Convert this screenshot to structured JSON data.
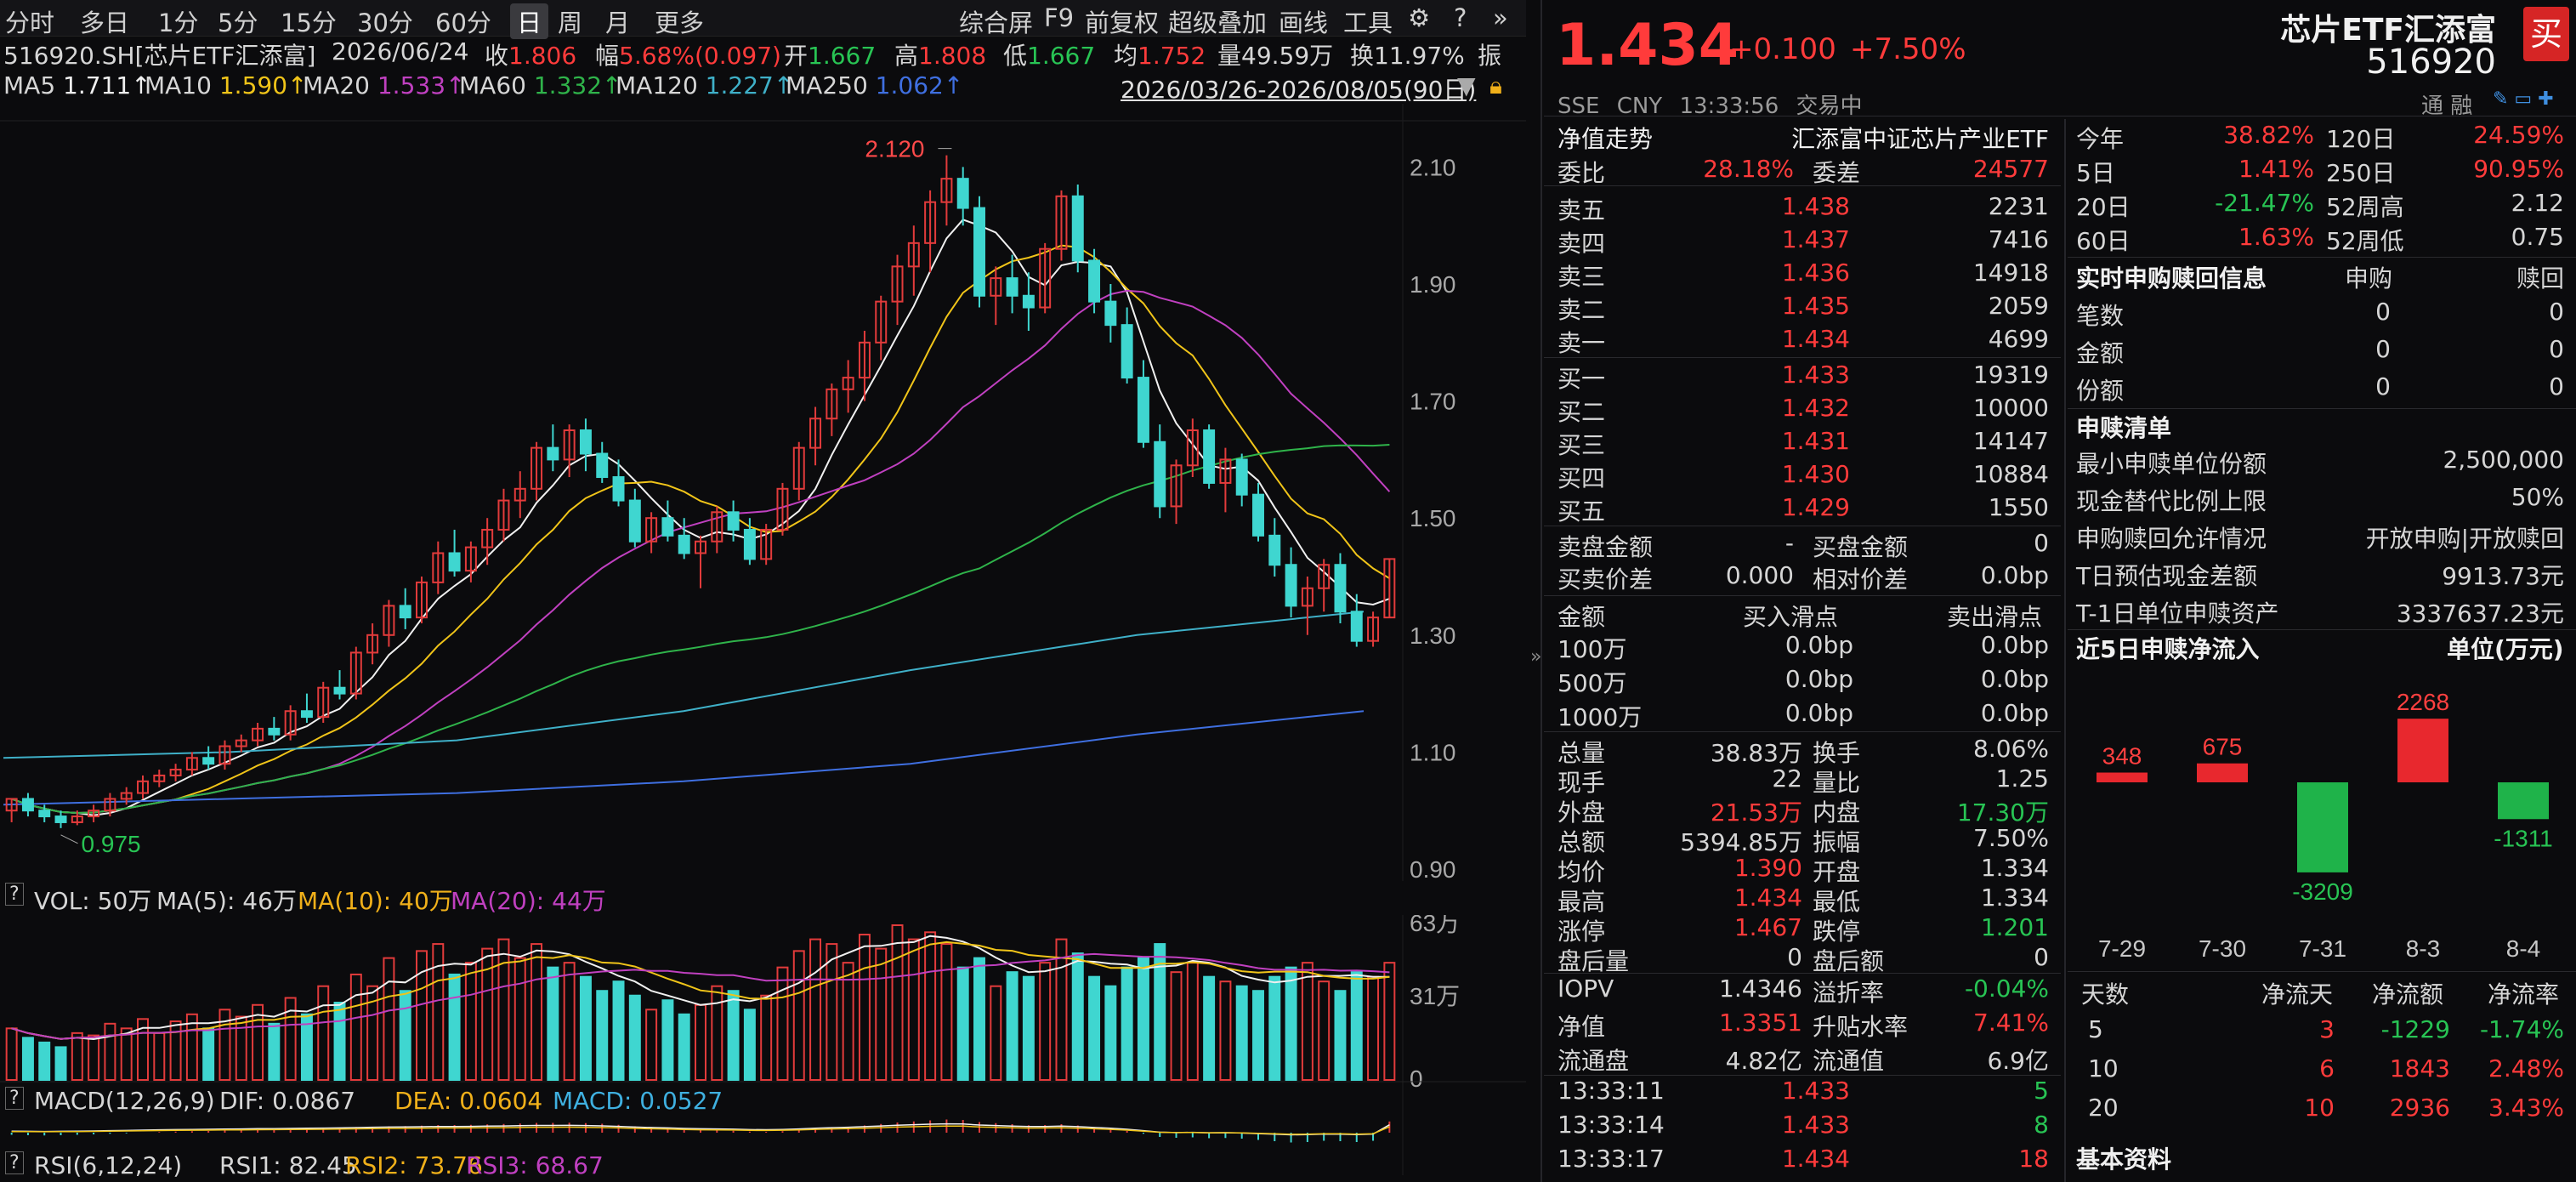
{
  "toolbar": {
    "periods": [
      "分时",
      "多日",
      "1分",
      "5分",
      "15分",
      "30分",
      "60分",
      "日",
      "周",
      "月",
      "更多"
    ],
    "active_period": "日",
    "right_items": [
      "综合屏",
      "F9",
      "前复权",
      "超级叠加",
      "画线",
      "工具"
    ]
  },
  "info": {
    "code": "516920.SH[芯片ETF汇添富]",
    "date": "2026/06/24",
    "close_label": "收",
    "close": "1.806",
    "chg_label": "幅",
    "chg": "5.68%(0.097)",
    "open_label": "开",
    "open": "1.667",
    "high_label": "高",
    "high": "1.808",
    "low_label": "低",
    "low": "1.667",
    "avg_label": "均",
    "avg": "1.752",
    "vol_label": "量",
    "vol": "49.59万",
    "turn_label": "换",
    "turn": "11.97%",
    "amp_label": "振"
  },
  "ma": {
    "ma5_label": "MA5",
    "ma5": "1.711↑",
    "ma10_label": "MA10",
    "ma10": "1.590↑",
    "ma20_label": "MA20",
    "ma20": "1.533↑",
    "ma60_label": "MA60",
    "ma60": "1.332↑",
    "ma120_label": "MA120",
    "ma120": "1.227↑",
    "ma250_label": "MA250",
    "ma250": "1.062↑",
    "range": "2026/03/26-2026/08/05(90日)"
  },
  "colors": {
    "ma5": "#f0f0f0",
    "ma10": "#f0c419",
    "ma20": "#c040c0",
    "ma60": "#2fb34a",
    "ma120": "#3fb0c8",
    "ma250": "#3f6fe0",
    "up": "#e23b3b",
    "down": "#3fd6d0"
  },
  "chart_data": {
    "type": "candlestick",
    "price_axis_ticks": [
      "2.10",
      "1.90",
      "1.70",
      "1.50",
      "1.30",
      "1.10",
      "0.90"
    ],
    "ylim": [
      0.9,
      2.15
    ],
    "max_label": "2.120",
    "min_label": "0.975",
    "volume_axis_ticks": [
      "63万",
      "31万",
      "0"
    ],
    "vol_label": "VOL: 50万",
    "vol_ma5": "MA(5): 46万",
    "vol_ma10": "MA(10): 40万",
    "vol_ma20": "MA(20): 44万",
    "macd_label": "MACD(12,26,9)",
    "dif": "DIF: 0.0867",
    "dea": "DEA: 0.0604",
    "macd": "MACD: 0.0527",
    "rsi_label": "RSI(6,12,24)",
    "rsi1": "RSI1: 82.45",
    "rsi2": "RSI2: 73.76",
    "rsi3": "RSI3: 68.67",
    "candles": [
      [
        1.0,
        1.02,
        0.98,
        1.02
      ],
      [
        1.02,
        1.03,
        0.99,
        1.0
      ],
      [
        1.0,
        1.01,
        0.98,
        0.99
      ],
      [
        0.99,
        1.0,
        0.97,
        0.98
      ],
      [
        0.98,
        1.0,
        0.975,
        0.99
      ],
      [
        0.99,
        1.01,
        0.98,
        1.0
      ],
      [
        1.0,
        1.03,
        0.99,
        1.02
      ],
      [
        1.02,
        1.04,
        1.01,
        1.03
      ],
      [
        1.03,
        1.06,
        1.02,
        1.05
      ],
      [
        1.05,
        1.07,
        1.04,
        1.06
      ],
      [
        1.06,
        1.08,
        1.05,
        1.07
      ],
      [
        1.07,
        1.1,
        1.06,
        1.09
      ],
      [
        1.09,
        1.11,
        1.07,
        1.08
      ],
      [
        1.08,
        1.12,
        1.07,
        1.11
      ],
      [
        1.11,
        1.13,
        1.1,
        1.12
      ],
      [
        1.12,
        1.15,
        1.11,
        1.14
      ],
      [
        1.14,
        1.16,
        1.12,
        1.13
      ],
      [
        1.13,
        1.18,
        1.12,
        1.17
      ],
      [
        1.17,
        1.2,
        1.15,
        1.16
      ],
      [
        1.16,
        1.22,
        1.15,
        1.21
      ],
      [
        1.21,
        1.24,
        1.19,
        1.2
      ],
      [
        1.2,
        1.28,
        1.19,
        1.27
      ],
      [
        1.27,
        1.32,
        1.25,
        1.3
      ],
      [
        1.3,
        1.36,
        1.28,
        1.35
      ],
      [
        1.35,
        1.38,
        1.31,
        1.33
      ],
      [
        1.33,
        1.4,
        1.32,
        1.39
      ],
      [
        1.39,
        1.46,
        1.37,
        1.44
      ],
      [
        1.44,
        1.48,
        1.4,
        1.41
      ],
      [
        1.41,
        1.46,
        1.39,
        1.45
      ],
      [
        1.45,
        1.5,
        1.42,
        1.48
      ],
      [
        1.48,
        1.55,
        1.46,
        1.53
      ],
      [
        1.53,
        1.58,
        1.5,
        1.55
      ],
      [
        1.55,
        1.63,
        1.53,
        1.62
      ],
      [
        1.62,
        1.66,
        1.58,
        1.6
      ],
      [
        1.6,
        1.66,
        1.57,
        1.65
      ],
      [
        1.65,
        1.67,
        1.58,
        1.61
      ],
      [
        1.61,
        1.63,
        1.56,
        1.57
      ],
      [
        1.57,
        1.6,
        1.52,
        1.53
      ],
      [
        1.53,
        1.55,
        1.45,
        1.46
      ],
      [
        1.46,
        1.51,
        1.44,
        1.5
      ],
      [
        1.5,
        1.53,
        1.46,
        1.47
      ],
      [
        1.47,
        1.5,
        1.43,
        1.44
      ],
      [
        1.44,
        1.47,
        1.38,
        1.46
      ],
      [
        1.46,
        1.52,
        1.44,
        1.51
      ],
      [
        1.51,
        1.53,
        1.46,
        1.48
      ],
      [
        1.48,
        1.5,
        1.42,
        1.43
      ],
      [
        1.43,
        1.49,
        1.42,
        1.48
      ],
      [
        1.48,
        1.56,
        1.47,
        1.55
      ],
      [
        1.55,
        1.63,
        1.53,
        1.62
      ],
      [
        1.62,
        1.69,
        1.59,
        1.67
      ],
      [
        1.67,
        1.73,
        1.64,
        1.72
      ],
      [
        1.72,
        1.77,
        1.68,
        1.74
      ],
      [
        1.74,
        1.82,
        1.7,
        1.8
      ],
      [
        1.8,
        1.88,
        1.77,
        1.87
      ],
      [
        1.87,
        1.95,
        1.83,
        1.93
      ],
      [
        1.93,
        2.0,
        1.88,
        1.97
      ],
      [
        1.97,
        2.06,
        1.92,
        2.04
      ],
      [
        2.04,
        2.12,
        2.0,
        2.08
      ],
      [
        2.08,
        2.1,
        2.0,
        2.03
      ],
      [
        2.03,
        2.05,
        1.86,
        1.88
      ],
      [
        1.88,
        1.93,
        1.83,
        1.91
      ],
      [
        1.91,
        1.95,
        1.85,
        1.88
      ],
      [
        1.88,
        1.92,
        1.82,
        1.86
      ],
      [
        1.86,
        1.97,
        1.85,
        1.96
      ],
      [
        1.96,
        2.06,
        1.94,
        2.05
      ],
      [
        2.05,
        2.07,
        1.92,
        1.94
      ],
      [
        1.94,
        1.96,
        1.85,
        1.87
      ],
      [
        1.87,
        1.9,
        1.8,
        1.83
      ],
      [
        1.83,
        1.86,
        1.73,
        1.74
      ],
      [
        1.74,
        1.77,
        1.62,
        1.63
      ],
      [
        1.63,
        1.66,
        1.5,
        1.52
      ],
      [
        1.52,
        1.6,
        1.49,
        1.59
      ],
      [
        1.59,
        1.67,
        1.57,
        1.65
      ],
      [
        1.65,
        1.66,
        1.55,
        1.56
      ],
      [
        1.56,
        1.62,
        1.51,
        1.6
      ],
      [
        1.6,
        1.61,
        1.52,
        1.54
      ],
      [
        1.54,
        1.56,
        1.46,
        1.47
      ],
      [
        1.47,
        1.5,
        1.4,
        1.42
      ],
      [
        1.42,
        1.45,
        1.33,
        1.35
      ],
      [
        1.35,
        1.4,
        1.3,
        1.38
      ],
      [
        1.38,
        1.43,
        1.34,
        1.42
      ],
      [
        1.42,
        1.44,
        1.32,
        1.34
      ],
      [
        1.34,
        1.37,
        1.28,
        1.29
      ],
      [
        1.29,
        1.34,
        1.28,
        1.33
      ],
      [
        1.33,
        1.43,
        1.33,
        1.43
      ]
    ],
    "volumes": [
      22,
      18,
      16,
      14,
      20,
      19,
      24,
      22,
      26,
      20,
      25,
      28,
      22,
      30,
      27,
      32,
      24,
      35,
      28,
      40,
      33,
      45,
      40,
      52,
      38,
      55,
      58,
      45,
      50,
      56,
      60,
      52,
      58,
      48,
      50,
      44,
      38,
      42,
      36,
      30,
      34,
      28,
      32,
      40,
      38,
      30,
      36,
      48,
      55,
      60,
      58,
      50,
      62,
      56,
      66,
      60,
      63,
      58,
      48,
      52,
      40,
      46,
      44,
      50,
      60,
      54,
      44,
      40,
      48,
      52,
      58,
      46,
      50,
      44,
      42,
      40,
      38,
      44,
      48,
      50,
      42,
      38,
      46,
      44,
      50
    ],
    "macd_vals": [
      -0.01,
      -0.012,
      -0.013,
      -0.012,
      -0.01,
      -0.008,
      -0.005,
      -0.003,
      0,
      0.003,
      0.005,
      0.007,
      0.008,
      0.01,
      0.012,
      0.014,
      0.015,
      0.017,
      0.018,
      0.02,
      0.022,
      0.025,
      0.028,
      0.03,
      0.031,
      0.033,
      0.036,
      0.036,
      0.037,
      0.039,
      0.041,
      0.043,
      0.046,
      0.046,
      0.047,
      0.045,
      0.042,
      0.037,
      0.03,
      0.026,
      0.022,
      0.017,
      0.013,
      0.012,
      0.009,
      0.005,
      0.004,
      0.007,
      0.012,
      0.018,
      0.024,
      0.028,
      0.034,
      0.041,
      0.048,
      0.053,
      0.058,
      0.062,
      0.06,
      0.05,
      0.045,
      0.04,
      0.035,
      0.036,
      0.04,
      0.034,
      0.026,
      0.018,
      0.008,
      -0.005,
      -0.02,
      -0.024,
      -0.022,
      -0.026,
      -0.025,
      -0.028,
      -0.034,
      -0.04,
      -0.046,
      -0.044,
      -0.038,
      -0.04,
      -0.044,
      -0.038,
      0.0527
    ]
  },
  "quote": {
    "price": "1.434",
    "change": "+0.100",
    "pct": "+7.50%",
    "name": "芯片ETF汇添富",
    "code": "516920",
    "market": "SSE",
    "currency": "CNY",
    "time": "13:33:56",
    "status": "交易中",
    "tags": "通 融",
    "buy_btn": "买"
  },
  "orderbook": {
    "nav_trend": "净值走势",
    "fund_name": "汇添富中证芯片产业ETF",
    "wb_label": "委比",
    "wb": "28.18%",
    "wc_label": "委差",
    "wc": "24577",
    "asks": [
      {
        "label": "卖五",
        "price": "1.438",
        "vol": "2231"
      },
      {
        "label": "卖四",
        "price": "1.437",
        "vol": "7416"
      },
      {
        "label": "卖三",
        "price": "1.436",
        "vol": "14918"
      },
      {
        "label": "卖二",
        "price": "1.435",
        "vol": "2059"
      },
      {
        "label": "卖一",
        "price": "1.434",
        "vol": "4699"
      }
    ],
    "bids": [
      {
        "label": "买一",
        "price": "1.433",
        "vol": "19319"
      },
      {
        "label": "买二",
        "price": "1.432",
        "vol": "10000"
      },
      {
        "label": "买三",
        "price": "1.431",
        "vol": "14147"
      },
      {
        "label": "买四",
        "price": "1.430",
        "vol": "10884"
      },
      {
        "label": "买五",
        "price": "1.429",
        "vol": "1550"
      }
    ],
    "sell_amt_label": "卖盘金额",
    "sell_amt": "-",
    "buy_amt_label": "买盘金额",
    "buy_amt": "0",
    "spread_label": "买卖价差",
    "spread": "0.000",
    "rel_spread_label": "相对价差",
    "rel_spread": "0.0bp"
  },
  "slippage": {
    "headers": [
      "金额",
      "买入滑点",
      "卖出滑点"
    ],
    "rows": [
      [
        "100万",
        "0.0bp",
        "0.0bp"
      ],
      [
        "500万",
        "0.0bp",
        "0.0bp"
      ],
      [
        "1000万",
        "0.0bp",
        "0.0bp"
      ]
    ]
  },
  "stats": {
    "rows": [
      [
        "总量",
        "38.83万",
        "换手",
        "8.06%"
      ],
      [
        "现手",
        "22",
        "量比",
        "1.25"
      ],
      [
        "外盘",
        "21.53万",
        "内盘",
        "17.30万"
      ],
      [
        "总额",
        "5394.85万",
        "振幅",
        "7.50%"
      ],
      [
        "均价",
        "1.390",
        "开盘",
        "1.334"
      ],
      [
        "最高",
        "1.434",
        "最低",
        "1.334"
      ],
      [
        "涨停",
        "1.467",
        "跌停",
        "1.201"
      ],
      [
        "盘后量",
        "0",
        "盘后额",
        "0"
      ]
    ],
    "iopv_rows": [
      [
        "IOPV",
        "1.4346",
        "溢折率",
        "-0.04%"
      ],
      [
        "净值",
        "1.3351",
        "升贴水率",
        "7.41%"
      ],
      [
        "流通盘",
        "4.82亿",
        "流通值",
        "6.9亿"
      ]
    ],
    "ticks": [
      [
        "13:33:11",
        "1.433",
        "5"
      ],
      [
        "13:33:14",
        "1.433",
        "8"
      ],
      [
        "13:33:17",
        "1.434",
        "18"
      ]
    ]
  },
  "perf": {
    "rows": [
      [
        "今年",
        "38.82%",
        "120日",
        "24.59%"
      ],
      [
        "5日",
        "1.41%",
        "250日",
        "90.95%"
      ],
      [
        "20日",
        "-21.47%",
        "52周高",
        "2.12"
      ],
      [
        "60日",
        "1.63%",
        "52周低",
        "0.75"
      ]
    ]
  },
  "creation": {
    "title": "实时申购赎回信息",
    "col1": "申购",
    "col2": "赎回",
    "rows": [
      [
        "笔数",
        "0",
        "0"
      ],
      [
        "金额",
        "0",
        "0"
      ],
      [
        "份额",
        "0",
        "0"
      ]
    ],
    "list_title": "申赎清单",
    "list": [
      [
        "最小申赎单位份额",
        "2,500,000"
      ],
      [
        "现金替代比例上限",
        "50%"
      ],
      [
        "申购赎回允许情况",
        "开放申购|开放赎回"
      ],
      [
        "T日预估现金差额",
        "9913.73元"
      ],
      [
        "T-1日单位申赎资产",
        "3337637.23元"
      ]
    ]
  },
  "flow": {
    "title": "近5日申赎净流入",
    "unit": "单位(万元)",
    "days": [
      "7-29",
      "7-30",
      "7-31",
      "8-3",
      "8-4"
    ],
    "values": [
      348,
      675,
      -3209,
      2268,
      -1311
    ],
    "table_headers": [
      "天数",
      "净流天",
      "净流额",
      "净流率"
    ],
    "table": [
      [
        "5",
        "3",
        "-1229",
        "-1.74%"
      ],
      [
        "10",
        "6",
        "1843",
        "2.48%"
      ],
      [
        "20",
        "10",
        "2936",
        "3.43%"
      ]
    ],
    "basic": "基本资料"
  }
}
